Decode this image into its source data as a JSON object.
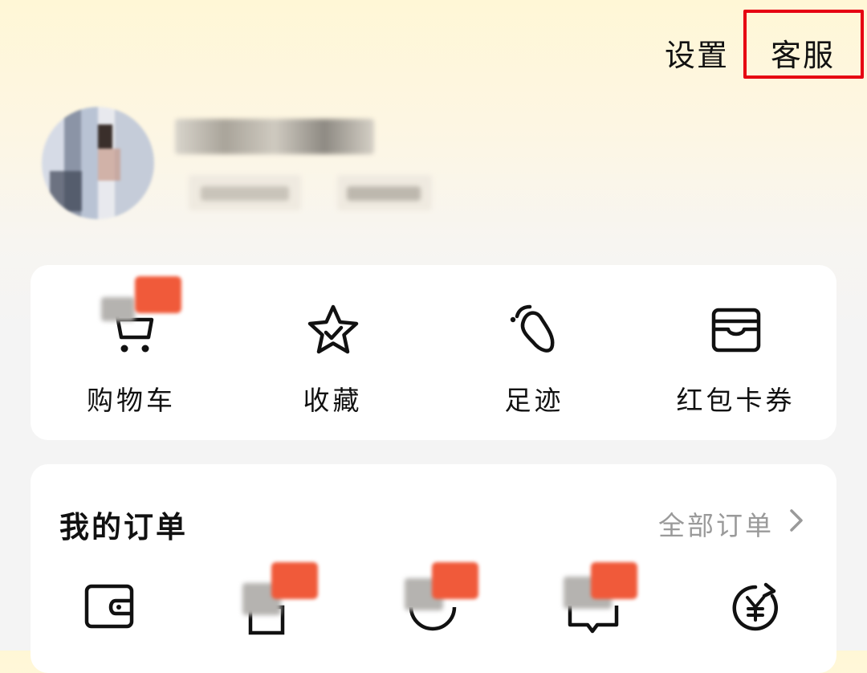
{
  "header": {
    "settings_label": "设置",
    "service_label": "客服"
  },
  "profile": {
    "avatar": "blurred-avatar"
  },
  "quick_actions": [
    {
      "label": "购物车",
      "icon": "cart-icon"
    },
    {
      "label": "收藏",
      "icon": "star-icon"
    },
    {
      "label": "足迹",
      "icon": "footprint-icon"
    },
    {
      "label": "红包卡券",
      "icon": "wallet-card-icon"
    }
  ],
  "orders": {
    "title": "我的订单",
    "all_label": "全部订单",
    "icons": [
      "wallet-icon",
      "truck-icon",
      "clock-icon",
      "comment-icon",
      "refund-icon"
    ]
  },
  "colors": {
    "highlight": "#e60012",
    "badge": "#f05a3a",
    "muted_text": "#9a9a9a"
  }
}
